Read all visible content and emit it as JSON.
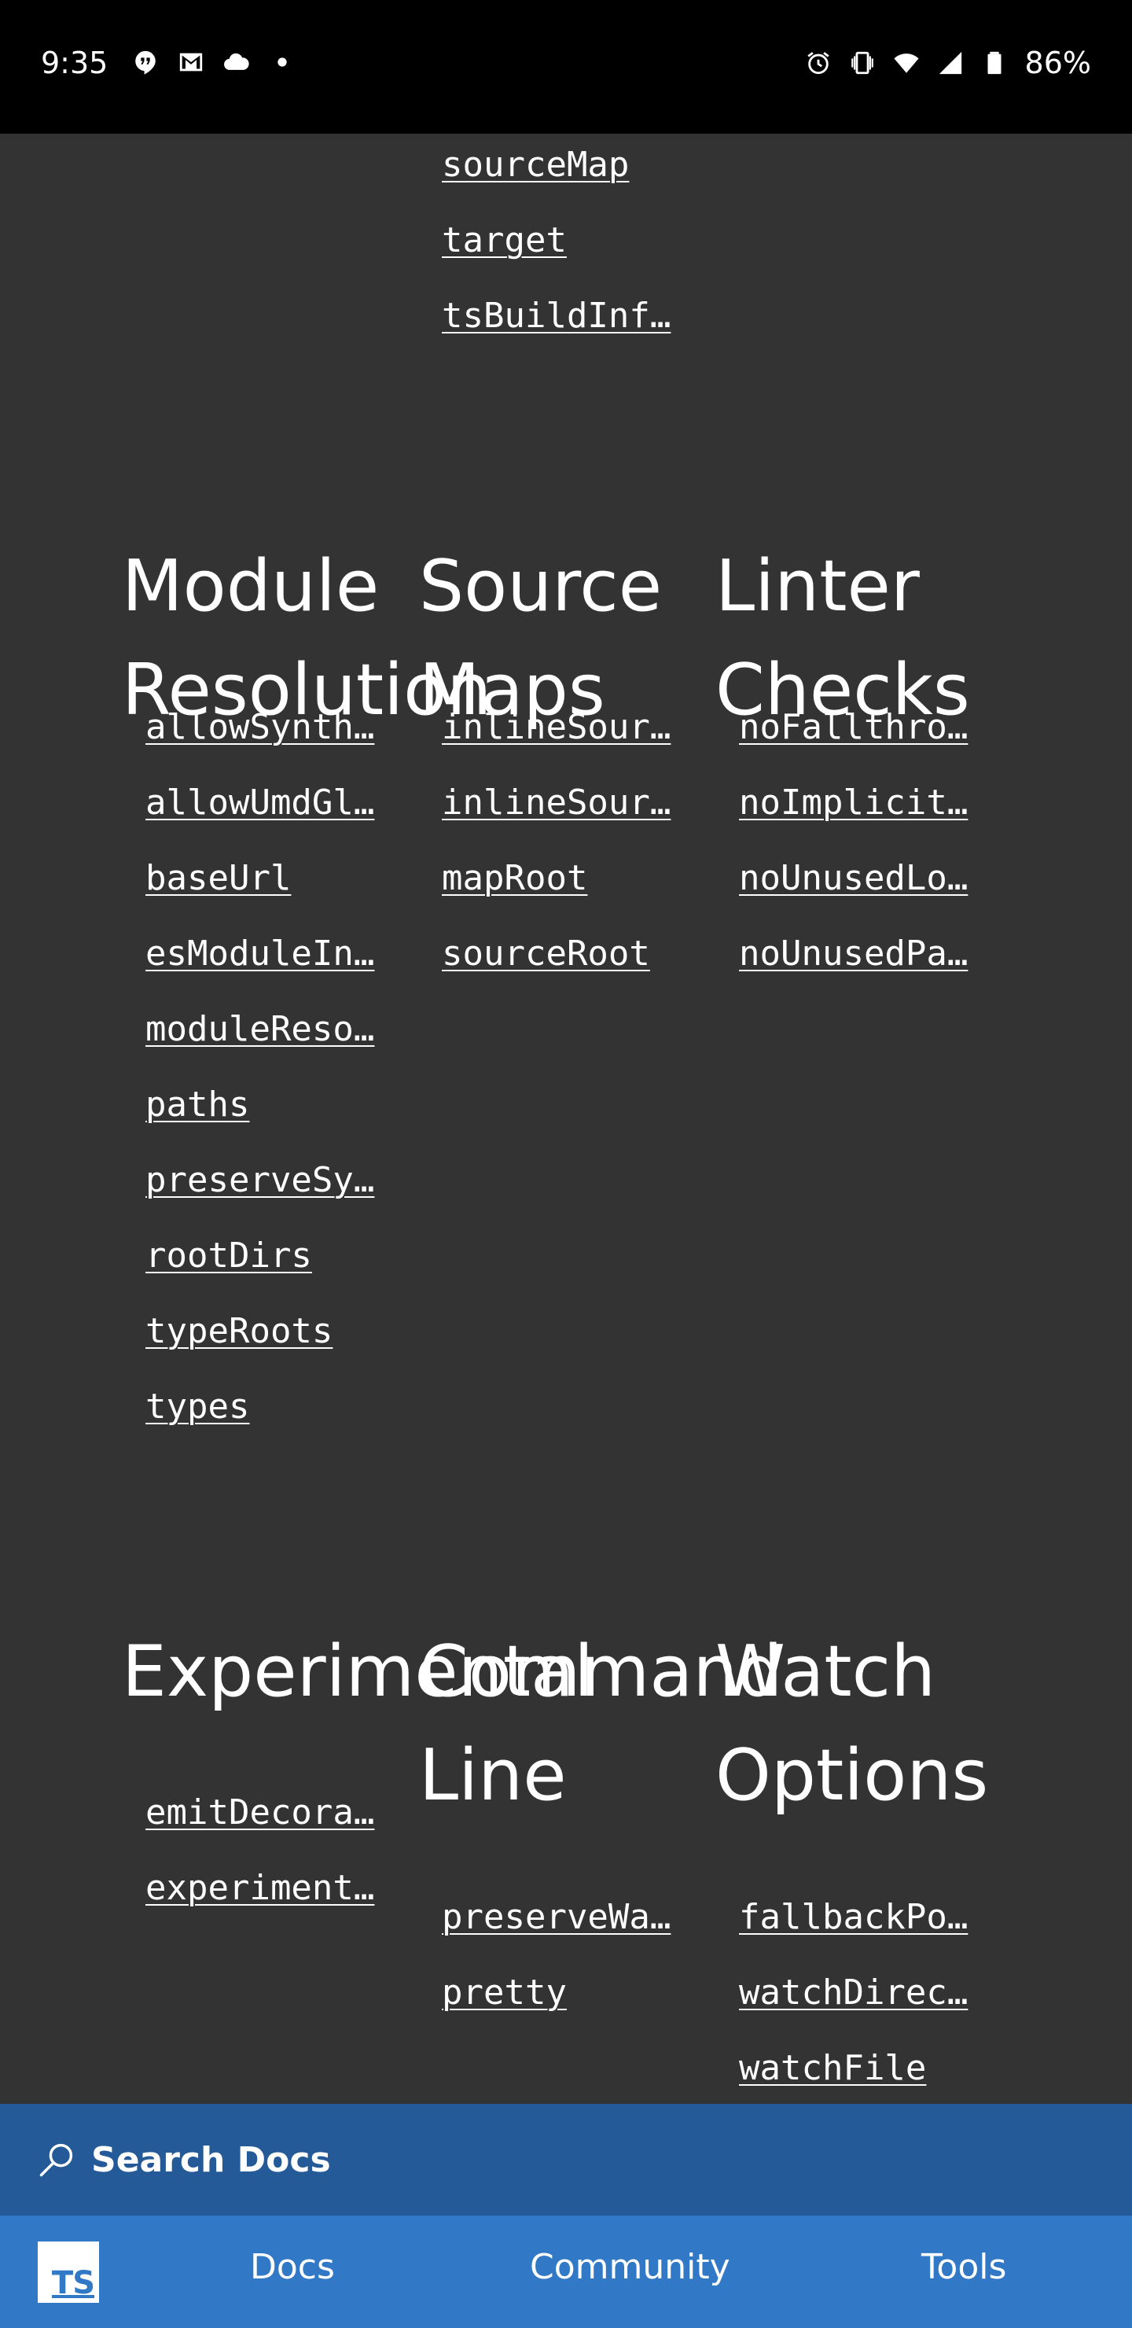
{
  "status_bar": {
    "time": "9:35",
    "battery": "86%",
    "left_icons": [
      "hangouts-icon",
      "gmail-icon",
      "cloud-icon",
      "dot-icon"
    ],
    "right_icons": [
      "alarm-icon",
      "vibrate-icon",
      "wifi-icon",
      "signal-icon",
      "battery-icon"
    ]
  },
  "top_links": [
    "sourceMap",
    "target",
    "tsBuildInf…"
  ],
  "sections": [
    {
      "title": "Module Resolution",
      "links": [
        "allowSynth…",
        "allowUmdGl…",
        "baseUrl",
        "esModuleIn…",
        "moduleReso…",
        "paths",
        "preserveSy…",
        "rootDirs",
        "typeRoots",
        "types"
      ]
    },
    {
      "title": "Source Maps",
      "links": [
        "inlineSour…",
        "inlineSour…",
        "mapRoot",
        "sourceRoot"
      ]
    },
    {
      "title": "Linter Checks",
      "links": [
        "noFallthro…",
        "noImplicit…",
        "noUnusedLo…",
        "noUnusedPa…"
      ]
    },
    {
      "title": "Experimental",
      "links": [
        "emitDecora…",
        "experiment…"
      ]
    },
    {
      "title": "Command Line",
      "links": [
        "preserveWa…",
        "pretty"
      ]
    },
    {
      "title": "Watch Options",
      "links": [
        "fallbackPo…",
        "watchDirec…",
        "watchFile"
      ]
    }
  ],
  "search": {
    "label": "Search Docs"
  },
  "bottom_nav": {
    "logo": "TS",
    "items": [
      "Docs",
      "Community",
      "Tools"
    ]
  },
  "colors": {
    "background": "#333333",
    "status_bar": "#000000",
    "search_bar": "#235a97",
    "bottom_nav": "#3178c6"
  }
}
